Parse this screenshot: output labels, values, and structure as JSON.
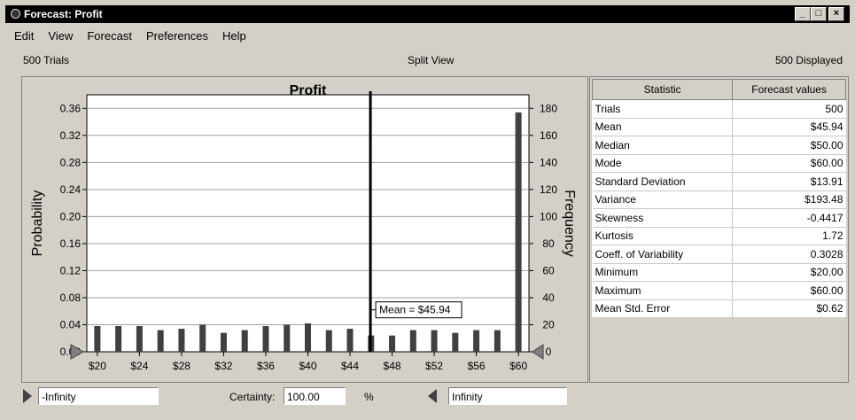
{
  "window": {
    "title": "Forecast: Profit",
    "btn_min": "_",
    "btn_max": "□",
    "btn_close": "×"
  },
  "menu": [
    "Edit",
    "View",
    "Forecast",
    "Preferences",
    "Help"
  ],
  "info": {
    "trials": "500 Trials",
    "view": "Split View",
    "displayed": "500 Displayed"
  },
  "chart_data": {
    "type": "bar",
    "title": "Profit",
    "ylabel": "Probability",
    "y2label": "Frequency",
    "x_ticks": [
      "$20",
      "$24",
      "$28",
      "$32",
      "$36",
      "$40",
      "$44",
      "$48",
      "$52",
      "$56",
      "$60"
    ],
    "y_ticks": [
      "0.00",
      "0.04",
      "0.08",
      "0.12",
      "0.16",
      "0.20",
      "0.24",
      "0.28",
      "0.32",
      "0.36"
    ],
    "y2_ticks": [
      "0",
      "20",
      "40",
      "60",
      "80",
      "100",
      "120",
      "140",
      "160",
      "180"
    ],
    "ylim": [
      0,
      0.38
    ],
    "xlim": [
      19,
      61
    ],
    "x": [
      20,
      22,
      24,
      26,
      28,
      30,
      32,
      34,
      36,
      38,
      40,
      42,
      44,
      46,
      48,
      50,
      52,
      54,
      56,
      58,
      60
    ],
    "values": [
      0.038,
      0.038,
      0.038,
      0.032,
      0.034,
      0.04,
      0.028,
      0.032,
      0.038,
      0.04,
      0.042,
      0.032,
      0.034,
      0.024,
      0.024,
      0.032,
      0.032,
      0.028,
      0.032,
      0.032,
      0.354
    ],
    "mean_value": 45.94,
    "mean_label": "Mean = $45.94",
    "bar_color": "#404040"
  },
  "stats": {
    "header": [
      "Statistic",
      "Forecast values"
    ],
    "rows": [
      [
        "Trials",
        "500"
      ],
      [
        "Mean",
        "$45.94"
      ],
      [
        "Median",
        "$50.00"
      ],
      [
        "Mode",
        "$60.00"
      ],
      [
        "Standard Deviation",
        "$13.91"
      ],
      [
        "Variance",
        "$193.48"
      ],
      [
        "Skewness",
        "-0.4417"
      ],
      [
        "Kurtosis",
        "1.72"
      ],
      [
        "Coeff. of Variability",
        "0.3028"
      ],
      [
        "Minimum",
        "$20.00"
      ],
      [
        "Maximum",
        "$60.00"
      ],
      [
        "Mean Std. Error",
        "$0.62"
      ]
    ]
  },
  "bottom": {
    "left_value": "-Infinity",
    "certainty_label": "Certainty:",
    "certainty_value": "100.00",
    "percent": "%",
    "right_value": "Infinity"
  }
}
